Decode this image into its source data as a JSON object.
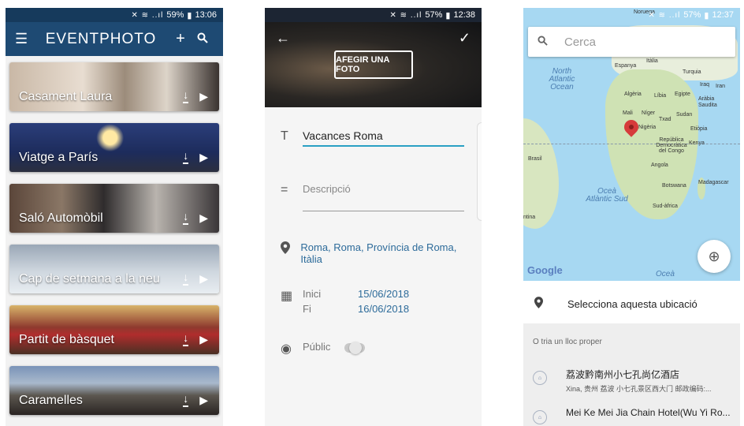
{
  "screen1": {
    "status": {
      "battery": "59%",
      "time": "13:06"
    },
    "appbar": {
      "menu_icon": "menu-icon",
      "title": "EVENTPHOTO",
      "add_icon": "add-icon",
      "search_icon": "search-icon"
    },
    "events": [
      {
        "title": "Casament Laura"
      },
      {
        "title": "Viatge a París"
      },
      {
        "title": "Saló Automòbil"
      },
      {
        "title": "Cap de setmana a la neu"
      },
      {
        "title": "Partit de bàsquet"
      },
      {
        "title": "Caramelles"
      }
    ]
  },
  "screen2": {
    "status": {
      "battery": "57%",
      "time": "12:38"
    },
    "add_photo_label": "AFEGIR UNA FOTO",
    "name_value": "Vacances Roma",
    "description_placeholder": "Descripció",
    "location": "Roma, Roma, Província de Roma, Itàlia",
    "dates": {
      "start_label": "Inici",
      "start_value": "15/06/2018",
      "end_label": "Fi",
      "end_value": "16/06/2018"
    },
    "public_label": "Públic",
    "public_enabled": false
  },
  "screen3": {
    "status": {
      "battery": "57%",
      "time": "12:37"
    },
    "search_placeholder": "Cerca",
    "map_labels": {
      "north_atlantic": "North Atlantic Ocean",
      "south_atlantic": "Oceà Atlàntic Sud",
      "ocea": "Oceà",
      "espanya": "Espanya",
      "italia": "Itàlia",
      "turquia": "Turquia",
      "iraq": "Iraq",
      "iran": "Iran",
      "algeria": "Algèria",
      "libia": "Líbia",
      "egipte": "Egipte",
      "arabia": "Aràbia Saudita",
      "mali": "Mali",
      "niger": "Níger",
      "txad": "Txad",
      "sudan": "Sudan",
      "nigeria": "Nigèria",
      "etiopia": "Etiòpia",
      "congo": "República Democràtica del Congo",
      "kenya": "Kenya",
      "angola": "Angola",
      "botswana": "Botswana",
      "madagascar": "Madagascar",
      "sudafrica": "Sud-àfrica",
      "brasil": "Brasil",
      "argentina": "ntina",
      "noruega": "Noruega"
    },
    "google": "Google",
    "select_location_label": "Selecciona aquesta ubicació",
    "nearby_header": "O tria un lloc proper",
    "places": [
      {
        "name": "荔波黔南州小七孔尚亿酒店",
        "address": "Xina, 贵州 荔波 小七孔景区西大门 邮政编码:..."
      },
      {
        "name": "Mei Ke Mei Jia Chain Hotel(Wu Yi Ro...",
        "address": ""
      }
    ]
  }
}
